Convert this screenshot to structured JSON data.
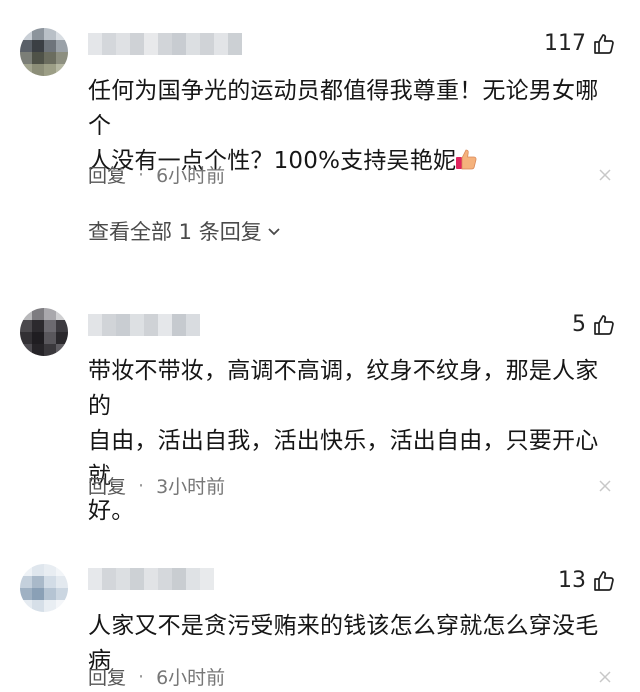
{
  "comments": [
    {
      "likes": "117",
      "text_lines": [
        "任何为国争光的运动员都值得我尊重！无论男女哪个",
        "人没有一点个性？100%支持吴艳妮"
      ],
      "reply_label": "回复",
      "time": "6小时前",
      "view_all": "查看全部 1 条回复"
    },
    {
      "likes": "5",
      "text_lines": [
        "带妆不带妆，高调不高调，纹身不纹身，那是人家的",
        "自由，活出自我，活出快乐，活出自由，只要开心就",
        "好。"
      ],
      "reply_label": "回复",
      "time": "3小时前"
    },
    {
      "likes": "13",
      "text_lines": [
        "人家又不是贪污受贿来的钱该怎么穿就怎么穿没毛病"
      ],
      "reply_label": "回复",
      "time": "6小时前"
    }
  ],
  "separator": "·",
  "icons": {
    "like": "thumbs-up-icon",
    "close": "close-icon",
    "expand": "chevron-down-icon",
    "emoji": "thumbs-up-emoji-icon"
  },
  "colors": {
    "meta_text": "#777777",
    "body_text": "#161616",
    "close_icon": "#c8c8c8"
  }
}
